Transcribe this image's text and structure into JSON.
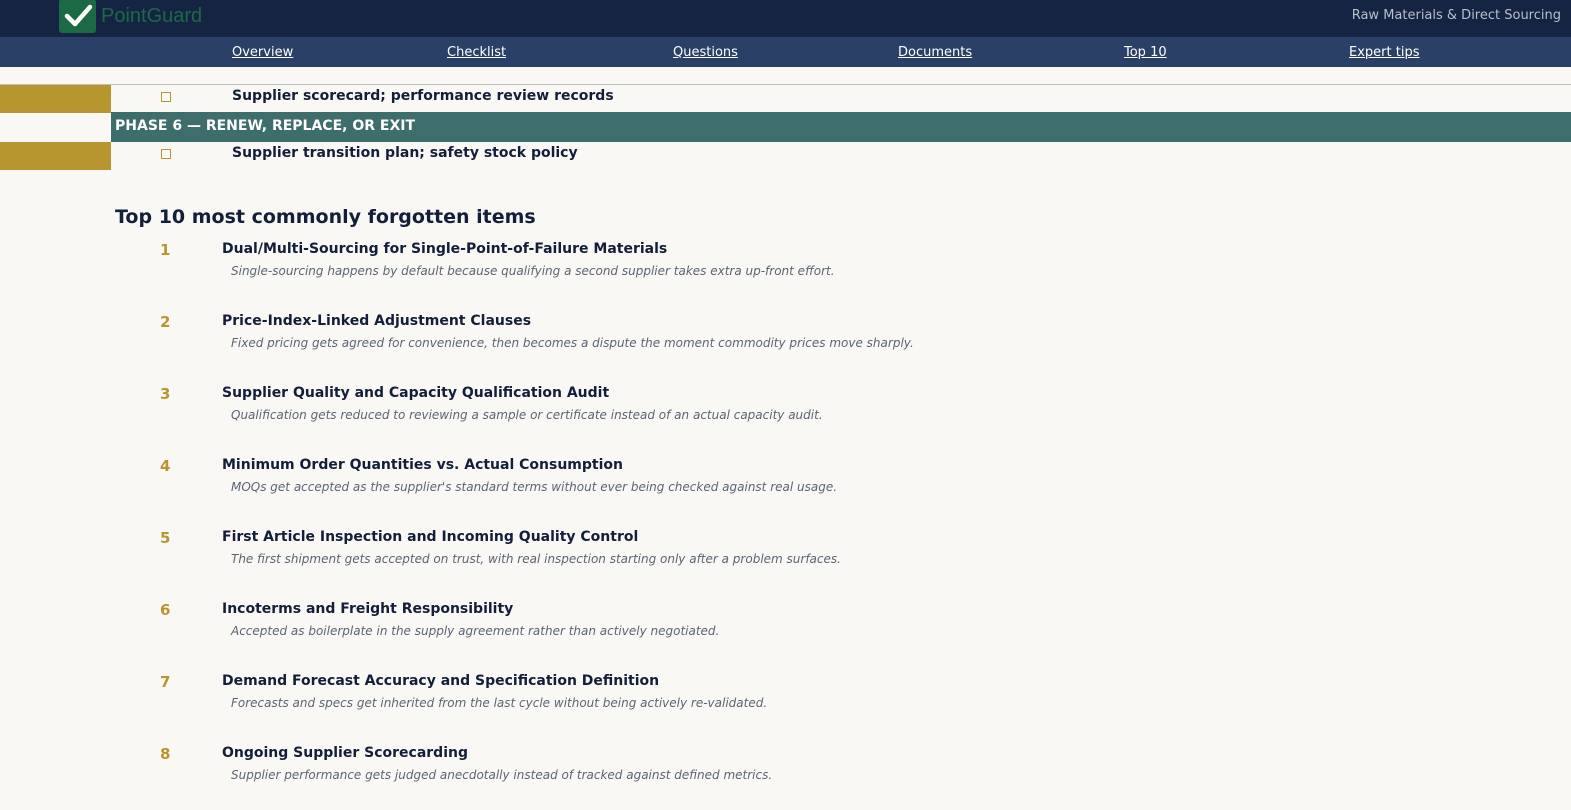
{
  "header": {
    "logo_text": "PointGuard",
    "app_name": "Raw Materials & Direct Sourcing",
    "colors": {
      "header_bg": "#152442",
      "nav_bg": "#2a4066",
      "logo_green": "#1c6a45",
      "gold": "#b8962f",
      "phase_teal": "#3e6e6c"
    }
  },
  "nav": {
    "items": [
      {
        "label": "Overview"
      },
      {
        "label": "Checklist"
      },
      {
        "label": "Questions"
      },
      {
        "label": "Documents"
      },
      {
        "label": "Top 10"
      },
      {
        "label": "Expert tips"
      }
    ]
  },
  "checklist": {
    "item_before": "Supplier scorecard; performance review records",
    "phase_heading": "PHASE 6 — RENEW, REPLACE, OR EXIT",
    "item_after": "Supplier transition plan; safety stock policy"
  },
  "top10": {
    "title": "Top 10 most commonly forgotten items",
    "items": [
      {
        "number": "1",
        "title": "Dual/Multi-Sourcing for Single-Point-of-Failure Materials",
        "description": "Single-sourcing happens by default because qualifying a second supplier takes extra up-front effort."
      },
      {
        "number": "2",
        "title": "Price-Index-Linked Adjustment Clauses",
        "description": "Fixed pricing gets agreed for convenience, then becomes a dispute the moment commodity prices move sharply."
      },
      {
        "number": "3",
        "title": "Supplier Quality and Capacity Qualification Audit",
        "description": "Qualification gets reduced to reviewing a sample or certificate instead of an actual capacity audit."
      },
      {
        "number": "4",
        "title": "Minimum Order Quantities vs. Actual Consumption",
        "description": "MOQs get accepted as the supplier's standard terms without ever being checked against real usage."
      },
      {
        "number": "5",
        "title": "First Article Inspection and Incoming Quality Control",
        "description": "The first shipment gets accepted on trust, with real inspection starting only after a problem surfaces."
      },
      {
        "number": "6",
        "title": "Incoterms and Freight Responsibility",
        "description": "Accepted as boilerplate in the supply agreement rather than actively negotiated."
      },
      {
        "number": "7",
        "title": "Demand Forecast Accuracy and Specification Definition",
        "description": "Forecasts and specs get inherited from the last cycle without being actively re-validated."
      },
      {
        "number": "8",
        "title": "Ongoing Supplier Scorecarding",
        "description": "Supplier performance gets judged anecdotally instead of tracked against defined metrics."
      }
    ]
  }
}
